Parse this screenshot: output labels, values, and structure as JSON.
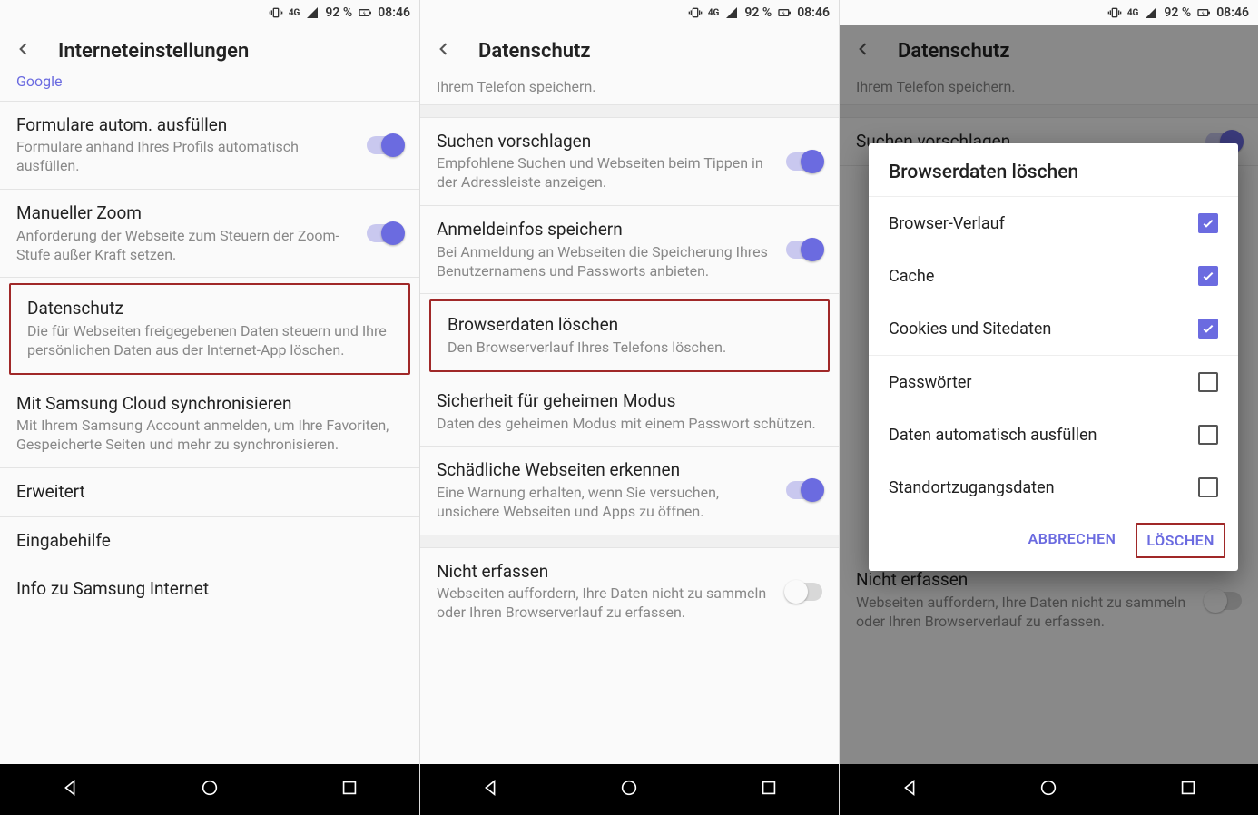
{
  "status": {
    "battery": "92 %",
    "time": "08:46",
    "net": "4G"
  },
  "screen1": {
    "title": "Interneteinstellungen",
    "search_engine_sub": "Google",
    "rows": {
      "autofill": {
        "t": "Formulare autom. ausfüllen",
        "s": "Formulare anhand Ihres Profils automatisch ausfüllen."
      },
      "zoom": {
        "t": "Manueller Zoom",
        "s": "Anforderung der Webseite zum Steuern der Zoom-Stufe außer Kraft setzen."
      },
      "privacy": {
        "t": "Datenschutz",
        "s": "Die für Webseiten freigegebenen Daten steuern und Ihre persönlichen Daten aus der Internet-App löschen."
      },
      "cloud": {
        "t": "Mit Samsung Cloud synchronisieren",
        "s": "Mit Ihrem Samsung Account anmelden, um Ihre Favoriten, Gespeicherte Seiten und mehr zu synchronisieren."
      },
      "advanced": {
        "t": "Erweitert"
      },
      "a11y": {
        "t": "Eingabehilfe"
      },
      "about": {
        "t": "Info zu Samsung Internet"
      }
    }
  },
  "screen2": {
    "title": "Datenschutz",
    "rows": {
      "cutoff_sub": "Ihrem Telefon speichern.",
      "suggest": {
        "t": "Suchen vorschlagen",
        "s": "Empfohlene Suchen und Webseiten beim Tippen in der Adressleiste anzeigen."
      },
      "signin": {
        "t": "Anmeldeinfos speichern",
        "s": "Bei Anmeldung an Webseiten die Speicherung Ihres Benutzernamens und Passworts anbieten."
      },
      "clear": {
        "t": "Browserdaten löschen",
        "s": "Den Browserverlauf Ihres Telefons löschen."
      },
      "secret": {
        "t": "Sicherheit für geheimen Modus",
        "s": "Daten des geheimen Modus mit einem Passwort schützen."
      },
      "harmful": {
        "t": "Schädliche Webseiten erkennen",
        "s": "Eine Warnung erhalten, wenn Sie versuchen, unsichere Webseiten und Apps zu öffnen."
      },
      "dnt": {
        "t": "Nicht erfassen",
        "s": "Webseiten auffordern, Ihre Daten nicht zu sammeln oder Ihren Browserverlauf zu erfassen."
      }
    }
  },
  "screen3": {
    "title": "Datenschutz",
    "rows": {
      "cutoff_sub": "Ihrem Telefon speichern.",
      "suggest": {
        "t": "Suchen vorschlagen"
      },
      "dnt": {
        "t": "Nicht erfassen",
        "s": "Webseiten auffordern, Ihre Daten nicht zu sammeln oder Ihren Browserverlauf zu erfassen."
      }
    },
    "dialog": {
      "title": "Browserdaten löschen",
      "items": [
        {
          "label": "Browser-Verlauf",
          "checked": true
        },
        {
          "label": "Cache",
          "checked": true
        },
        {
          "label": "Cookies und Sitedaten",
          "checked": true
        },
        {
          "label": "Passwörter",
          "checked": false
        },
        {
          "label": "Daten automatisch ausfüllen",
          "checked": false
        },
        {
          "label": "Standortzugangsdaten",
          "checked": false
        }
      ],
      "cancel": "ABBRECHEN",
      "confirm": "LÖSCHEN"
    }
  }
}
